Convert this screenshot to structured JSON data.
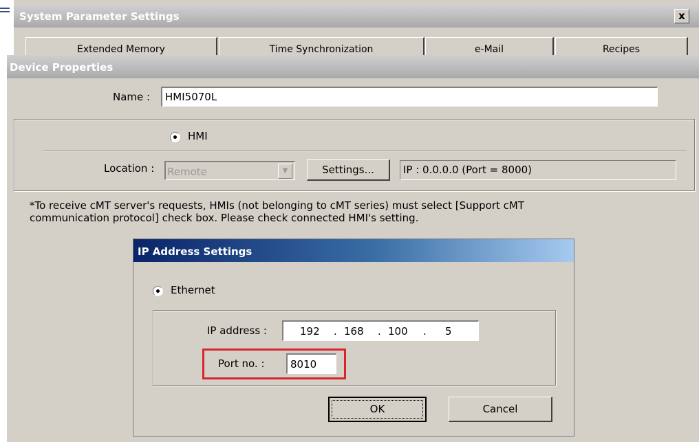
{
  "system_window": {
    "title": "System Parameter Settings",
    "close_label": "x",
    "tabs": [
      "Extended Memory",
      "Time Synchronization",
      "e-Mail",
      "Recipes"
    ]
  },
  "device_properties": {
    "title": "Device Properties",
    "name_label": "Name :",
    "name_value": "HMI5070L",
    "hmi_radio_label": "HMI",
    "location_label": "Location :",
    "location_value": "Remote",
    "settings_button": "Settings...",
    "ip_display": "IP : 0.0.0.0 (Port = 8000)",
    "note_line1": "*To receive cMT server's requests,  HMIs (not belonging to cMT series) must select [Support cMT",
    "note_line2": "communication protocol] check box. Please check connected HMI's setting."
  },
  "ip_dialog": {
    "title": "IP Address Settings",
    "ethernet_label": "Ethernet",
    "ip_label": "IP address :",
    "ip_octets": [
      "192",
      "168",
      "100",
      "5"
    ],
    "ip_dot": ".",
    "port_label": "Port no. :",
    "port_value": "8010",
    "ok_button": "OK",
    "cancel_button": "Cancel"
  },
  "colors": {
    "highlight": "#d9262b",
    "dialog_title_start": "#0a246a",
    "dialog_title_end": "#a6caf0",
    "window_face": "#d4d0c8"
  }
}
